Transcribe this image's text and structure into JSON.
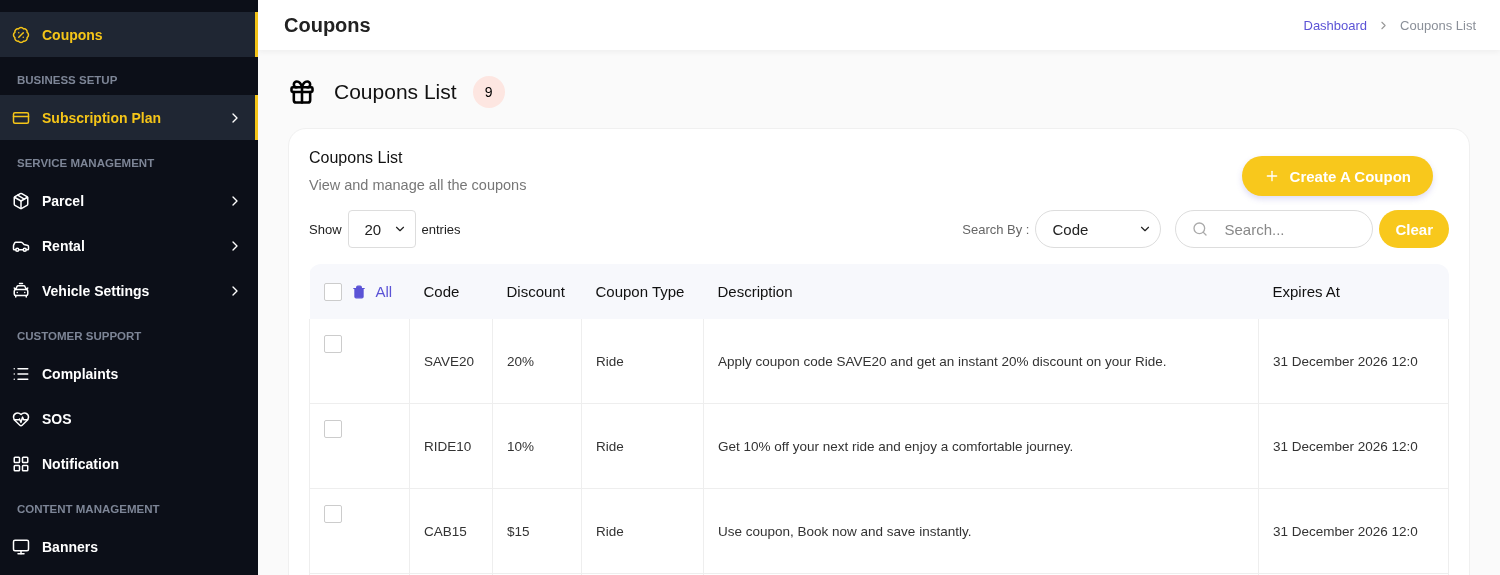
{
  "sidebar": {
    "items": [
      {
        "kind": "item",
        "label": "Coupons",
        "selected": true,
        "expandable": false
      },
      {
        "kind": "section",
        "label": "BUSINESS SETUP"
      },
      {
        "kind": "item",
        "label": "Subscription Plan",
        "selected": true,
        "expandable": true
      },
      {
        "kind": "section",
        "label": "SERVICE MANAGEMENT"
      },
      {
        "kind": "item",
        "label": "Parcel",
        "selected": false,
        "expandable": true
      },
      {
        "kind": "item",
        "label": "Rental",
        "selected": false,
        "expandable": true
      },
      {
        "kind": "item",
        "label": "Vehicle Settings",
        "selected": false,
        "expandable": true
      },
      {
        "kind": "section",
        "label": "CUSTOMER SUPPORT"
      },
      {
        "kind": "item",
        "label": "Complaints",
        "selected": false,
        "expandable": false
      },
      {
        "kind": "item",
        "label": "SOS",
        "selected": false,
        "expandable": false
      },
      {
        "kind": "item",
        "label": "Notification",
        "selected": false,
        "expandable": false
      },
      {
        "kind": "section",
        "label": "CONTENT MANAGEMENT"
      },
      {
        "kind": "item",
        "label": "Banners",
        "selected": false,
        "expandable": false
      }
    ]
  },
  "header": {
    "title": "Coupons",
    "breadcrumb": [
      {
        "label": "Dashboard",
        "link": true
      },
      {
        "label": "Coupons List",
        "link": false
      }
    ]
  },
  "page_heading": {
    "title": "Coupons List",
    "count": "9"
  },
  "card": {
    "title": "Coupons List",
    "subtitle": "View and manage all the coupons",
    "create_button": "Create A Coupon",
    "show_label": "Show",
    "entries_value": "20",
    "entries_label": "entries",
    "search_by_label": "Search By :",
    "search_by_value": "Code",
    "search_placeholder": "Search...",
    "clear_button": "Clear"
  },
  "table": {
    "select_all_checked": false,
    "select_all_label": "All",
    "columns": [
      "Code",
      "Discount",
      "Coupon Type",
      "Description",
      "Expires At"
    ],
    "rows": [
      {
        "checked": false,
        "cells": [
          "SAVE20",
          "20%",
          "Ride",
          "Apply coupon code SAVE20 and get an instant 20% discount on your Ride.",
          "31 December 2026 12:0"
        ]
      },
      {
        "checked": false,
        "cells": [
          "RIDE10",
          "10%",
          "Ride",
          "Get 10% off your next ride and enjoy a comfortable journey.",
          "31 December 2026 12:0"
        ]
      },
      {
        "checked": false,
        "cells": [
          "CAB15",
          "$15",
          "Ride",
          "Use coupon, Book now and save instantly.",
          "31 December 2026 12:0"
        ]
      }
    ]
  }
}
